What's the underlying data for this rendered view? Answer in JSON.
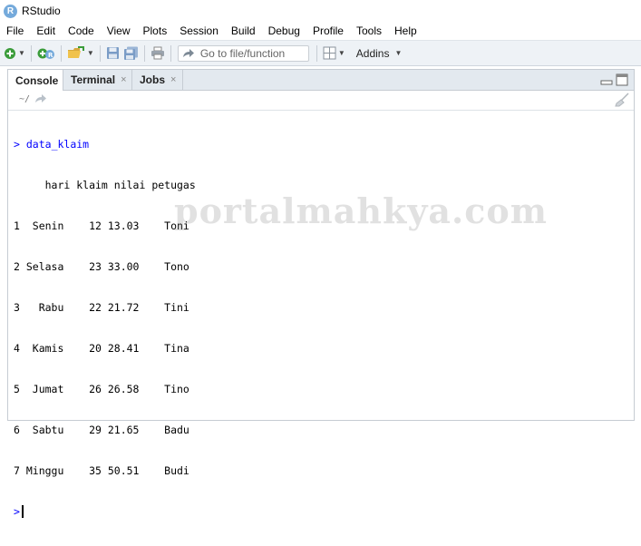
{
  "window": {
    "title": "RStudio",
    "logo_letter": "R"
  },
  "menu": [
    "File",
    "Edit",
    "Code",
    "View",
    "Plots",
    "Session",
    "Build",
    "Debug",
    "Profile",
    "Tools",
    "Help"
  ],
  "toolbar": {
    "goto_placeholder": "Go to file/function",
    "addins_label": "Addins"
  },
  "pane": {
    "tabs": [
      {
        "label": "Console",
        "active": true,
        "closable": false
      },
      {
        "label": "Terminal",
        "active": false,
        "closable": true
      },
      {
        "label": "Jobs",
        "active": false,
        "closable": true
      }
    ],
    "close_glyph": "×",
    "working_dir": "~/"
  },
  "console": {
    "prompt": ">",
    "command": "data_klaim",
    "table": {
      "header": "     hari klaim nilai petugas",
      "rows": [
        "1  Senin    12 13.03    Toni",
        "2 Selasa    23 33.00    Tono",
        "3   Rabu    22 21.72    Tini",
        "4  Kamis    20 28.41    Tina",
        "5  Jumat    26 26.58    Tino",
        "6  Sabtu    29 21.65    Badu",
        "7 Minggu    35 50.51    Budi"
      ]
    }
  },
  "watermark": "portalmahkya.com",
  "colors": {
    "prompt": "#0000ff",
    "toolbar_bg": "#eef2f6",
    "tab_bg": "#e3e9ef"
  }
}
